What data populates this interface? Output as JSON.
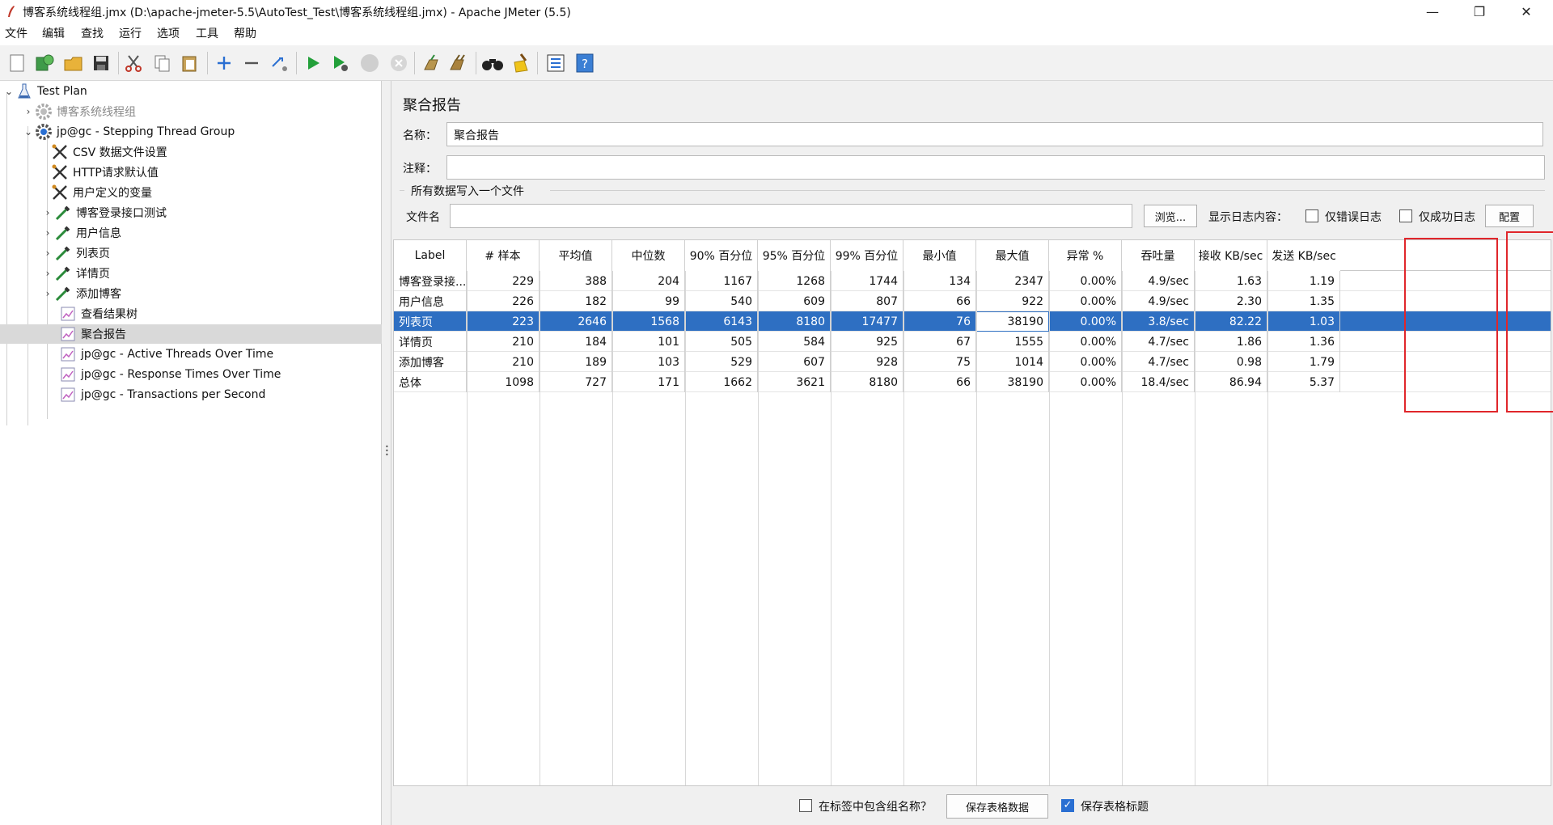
{
  "window": {
    "title": "博客系统线程组.jmx (D:\\apache-jmeter-5.5\\AutoTest_Test\\博客系统线程组.jmx) - Apache JMeter (5.5)",
    "minimize": "—",
    "maximize": "❐",
    "close": "✕"
  },
  "menu": [
    "文件",
    "编辑",
    "查找",
    "运行",
    "选项",
    "工具",
    "帮助"
  ],
  "toolbar": {
    "icons": [
      "new-icon",
      "templates-icon",
      "open-icon",
      "save-icon",
      "cut-icon",
      "copy-icon",
      "paste-icon",
      "expand-icon",
      "collapse-icon",
      "toggle-icon",
      "start-icon",
      "start-no-pause-icon",
      "stop-icon",
      "shutdown-icon",
      "clear-icon",
      "clear-all-icon",
      "search-icon",
      "reset-search-icon",
      "function-helper-icon",
      "help-icon"
    ]
  },
  "tree": {
    "items": [
      {
        "label": "Test Plan",
        "level": 0,
        "arrow": "⌄",
        "icon": "flask-icon"
      },
      {
        "label": "博客系统线程组",
        "level": 1,
        "arrow": "›",
        "icon": "gear-icon",
        "muted": true
      },
      {
        "label": "jp@gc - Stepping Thread Group",
        "level": 1,
        "arrow": "⌄",
        "icon": "gear-icon"
      },
      {
        "label": "CSV 数据文件设置",
        "level": 2,
        "arrow": "",
        "icon": "wrench-icon"
      },
      {
        "label": "HTTP请求默认值",
        "level": 2,
        "arrow": "",
        "icon": "wrench-icon"
      },
      {
        "label": "用户定义的变量",
        "level": 2,
        "arrow": "",
        "icon": "wrench-icon"
      },
      {
        "label": "博客登录接口测试",
        "level": 2,
        "arrow": "›",
        "icon": "pipette-icon"
      },
      {
        "label": "用户信息",
        "level": 2,
        "arrow": "›",
        "icon": "pipette-icon"
      },
      {
        "label": "列表页",
        "level": 2,
        "arrow": "›",
        "icon": "pipette-icon"
      },
      {
        "label": "详情页",
        "level": 2,
        "arrow": "›",
        "icon": "pipette-icon"
      },
      {
        "label": "添加博客",
        "level": 2,
        "arrow": "›",
        "icon": "pipette-icon"
      },
      {
        "label": "查看结果树",
        "level": 2,
        "arrow": "",
        "icon": "graph-icon"
      },
      {
        "label": "聚合报告",
        "level": 2,
        "arrow": "",
        "icon": "graph-icon",
        "selected": true
      },
      {
        "label": "jp@gc - Active Threads Over Time",
        "level": 2,
        "arrow": "",
        "icon": "graph-icon"
      },
      {
        "label": "jp@gc - Response Times Over Time",
        "level": 2,
        "arrow": "",
        "icon": "graph-icon"
      },
      {
        "label": "jp@gc - Transactions per Second",
        "level": 2,
        "arrow": "",
        "icon": "graph-icon"
      }
    ]
  },
  "panel": {
    "title": "聚合报告",
    "name_label": "名称：",
    "name_value": "聚合报告",
    "comment_label": "注释：",
    "comment_value": "",
    "group_label": "所有数据写入一个文件",
    "file_label": "文件名",
    "file_value": "",
    "browse_button": "浏览...",
    "log_label": "显示日志内容：",
    "errors_only": "仅错误日志",
    "success_only": "仅成功日志",
    "config_button": "配置"
  },
  "table": {
    "headers": [
      "Label",
      "# 样本",
      "平均值",
      "中位数",
      "90% 百分位",
      "95% 百分位",
      "99% 百分位",
      "最小值",
      "最大值",
      "异常 %",
      "吞吐量",
      "接收 KB/sec",
      "发送 KB/sec"
    ],
    "rows": [
      [
        "博客登录接...",
        "229",
        "388",
        "204",
        "1167",
        "1268",
        "1744",
        "134",
        "2347",
        "0.00%",
        "4.9/sec",
        "1.63",
        "1.19"
      ],
      [
        "用户信息",
        "226",
        "182",
        "99",
        "540",
        "609",
        "807",
        "66",
        "922",
        "0.00%",
        "4.9/sec",
        "2.30",
        "1.35"
      ],
      [
        "列表页",
        "223",
        "2646",
        "1568",
        "6143",
        "8180",
        "17477",
        "76",
        "38190",
        "0.00%",
        "3.8/sec",
        "82.22",
        "1.03"
      ],
      [
        "详情页",
        "210",
        "184",
        "101",
        "505",
        "584",
        "925",
        "67",
        "1555",
        "0.00%",
        "4.7/sec",
        "1.86",
        "1.36"
      ],
      [
        "添加博客",
        "210",
        "189",
        "103",
        "529",
        "607",
        "928",
        "75",
        "1014",
        "0.00%",
        "4.7/sec",
        "0.98",
        "1.79"
      ],
      [
        "总体",
        "1098",
        "727",
        "171",
        "1662",
        "3621",
        "8180",
        "66",
        "38190",
        "0.00%",
        "18.4/sec",
        "86.94",
        "5.37"
      ]
    ],
    "selected_row": 2,
    "highlight_color": "#e0262b",
    "selection_color": "#2e6fc2"
  },
  "footer": {
    "include_group_name": "在标签中包含组名称？",
    "save_table_data": "保存表格数据",
    "save_table_header": "保存表格标题",
    "include_group_checked": false,
    "save_header_checked": true
  }
}
